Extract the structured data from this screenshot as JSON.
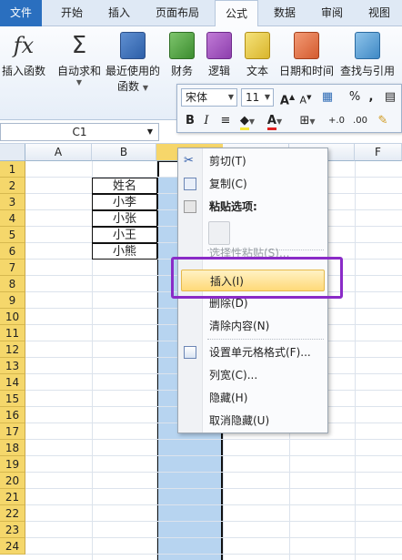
{
  "ribbon_tabs": [
    "文件",
    "开始",
    "插入",
    "页面布局",
    "公式",
    "数据",
    "审阅",
    "视图"
  ],
  "ribbon_buttons": {
    "insert_function": "插入函数",
    "autosum": "自动求和",
    "recent_used_line1": "最近使用的",
    "recent_used_line2": "函数",
    "financial": "财务",
    "logical": "逻辑",
    "text": "文本",
    "datetime": "日期和时间",
    "lookup": "查找与引用"
  },
  "mini_toolbar": {
    "font_name": "宋体",
    "font_size": "11",
    "bold": "B",
    "italic": "I",
    "percent": "%",
    "comma": ",",
    "font_color_letter": "A"
  },
  "name_box": "C1",
  "columns": [
    "A",
    "B",
    "C",
    "F"
  ],
  "rows": [
    "1",
    "2",
    "3",
    "4",
    "5",
    "6",
    "7",
    "8",
    "9",
    "10",
    "11",
    "12",
    "13",
    "14",
    "15",
    "16",
    "17",
    "18",
    "19",
    "20",
    "21",
    "22",
    "23",
    "24"
  ],
  "cells": [
    "姓名",
    "小李",
    "小张",
    "小王",
    "小熊"
  ],
  "context_menu": {
    "cut": "剪切(T)",
    "copy": "复制(C)",
    "paste_options": "粘贴选项:",
    "paste_special": "选择性粘贴(S)...",
    "insert": "插入(I)",
    "delete": "删除(D)",
    "clear": "清除内容(N)",
    "format_cells": "设置单元格格式(F)...",
    "column_width": "列宽(C)...",
    "hide": "隐藏(H)",
    "unhide": "取消隐藏(U)"
  },
  "colors": {
    "file_tab": "#2a6fbf",
    "row_header": "#f5d76b",
    "selection": "#b7d4f0",
    "menu_highlight": "#ffd978",
    "annotation_box": "#8a2bc7"
  }
}
